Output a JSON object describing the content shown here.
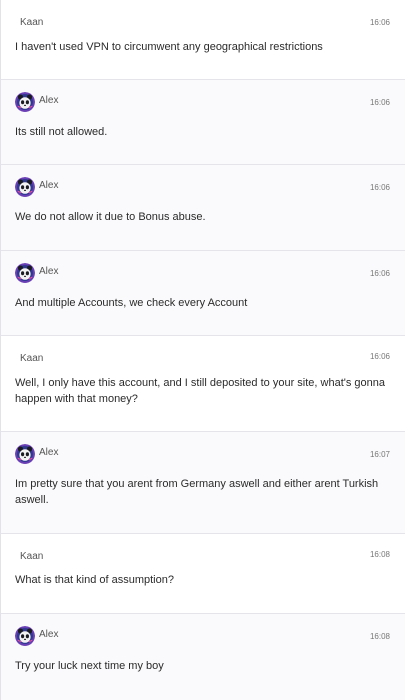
{
  "messages": [
    {
      "sender": "Kaan",
      "time": "16:06",
      "text": "I haven't used VPN to circumwent any geographical restrictions"
    },
    {
      "sender": "Alex",
      "time": "16:06",
      "text": "Its still not allowed."
    },
    {
      "sender": "Alex",
      "time": "16:06",
      "text": "We do not allow it due to Bonus abuse."
    },
    {
      "sender": "Alex",
      "time": "16:06",
      "text": "And multiple Accounts, we check every Account"
    },
    {
      "sender": "Kaan",
      "time": "16:06",
      "text": "Well, I only have this account, and I still deposited to your site, what's gonna happen with that money?"
    },
    {
      "sender": "Alex",
      "time": "16:07",
      "text": "Im pretty sure that you arent from Germany aswell and either arent Turkish aswell."
    },
    {
      "sender": "Kaan",
      "time": "16:08",
      "text": "What is that kind of assumption?"
    },
    {
      "sender": "Alex",
      "time": "16:08",
      "text": "Try your luck next time my boy"
    }
  ],
  "agent_avatar_icon": "panda-avatar-icon",
  "colors": {
    "agent_bg": "#fafafc",
    "user_bg": "#ffffff",
    "divider": "#e4e4ea",
    "avatar_bg": "#6a3fb5"
  }
}
